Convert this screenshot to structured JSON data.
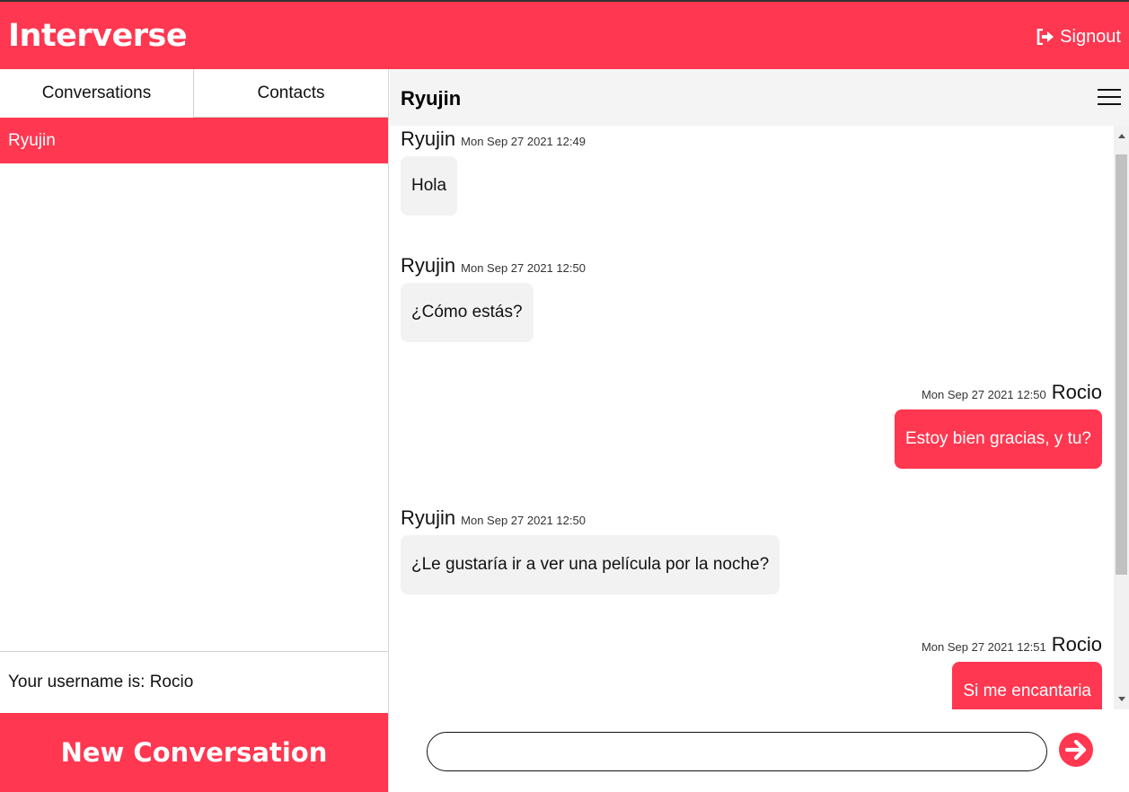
{
  "app": {
    "brand": "Interverse",
    "signout_label": "Signout",
    "accent_color": "#ff3750"
  },
  "sidebar": {
    "tabs": [
      {
        "label": "Conversations",
        "active": true
      },
      {
        "label": "Contacts",
        "active": false
      }
    ],
    "conversations": [
      {
        "name": "Ryujin",
        "selected": true
      }
    ],
    "username_text": "Your username is: Rocio",
    "new_conversation_label": "New Conversation"
  },
  "chat": {
    "title": "Ryujin",
    "messages": [
      {
        "sender": "Ryujin",
        "time": "Mon Sep 27 2021 12:49",
        "text": "Hola",
        "outgoing": false
      },
      {
        "sender": "Ryujin",
        "time": "Mon Sep 27 2021 12:50",
        "text": "¿Cómo estás?",
        "outgoing": false
      },
      {
        "sender": "Rocio",
        "time": "Mon Sep 27 2021 12:50",
        "text": "Estoy bien gracias, y tu?",
        "outgoing": true
      },
      {
        "sender": "Ryujin",
        "time": "Mon Sep 27 2021 12:50",
        "text": "¿Le gustaría ir a ver una película por la noche?",
        "outgoing": false
      },
      {
        "sender": "Rocio",
        "time": "Mon Sep 27 2021 12:51",
        "text": "Si me encantaria",
        "outgoing": true
      }
    ],
    "input": {
      "value": "",
      "placeholder": ""
    },
    "icons": {
      "menu": "hamburger-menu-icon",
      "send": "arrow-right-circle-icon",
      "signout": "sign-out-icon"
    }
  }
}
